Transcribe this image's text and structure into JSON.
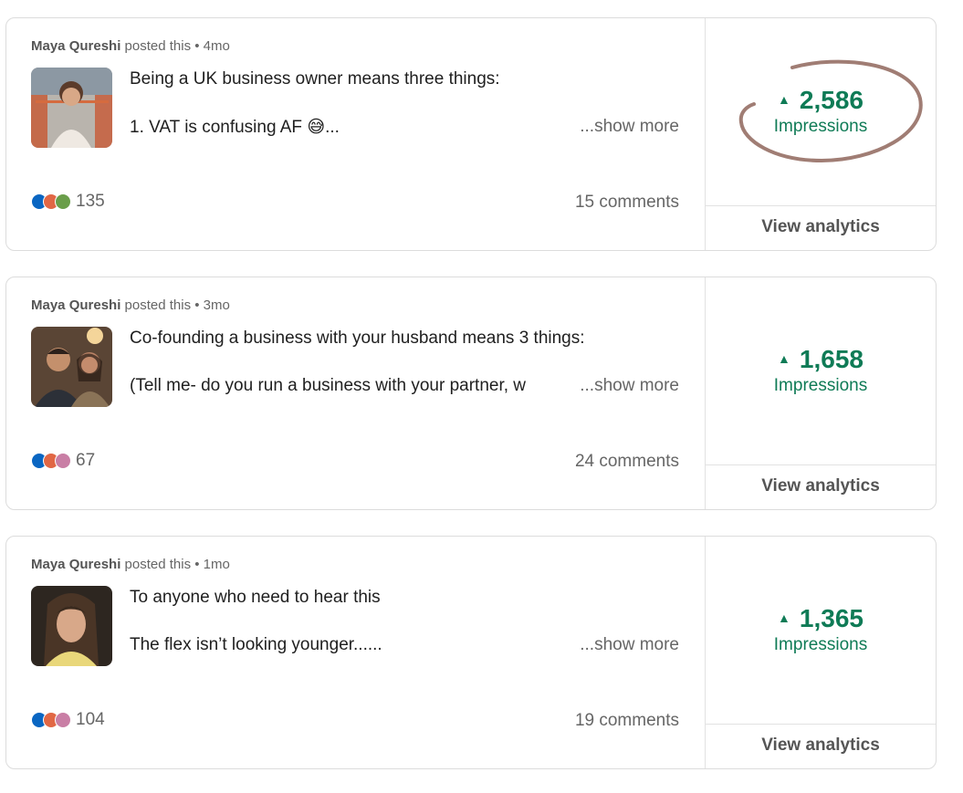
{
  "posts": [
    {
      "author": "Maya Qureshi",
      "meta": " posted this • 4mo",
      "line1": "Being a UK business owner means three things:",
      "line2": "1. VAT is confusing AF 😅...",
      "show_more": "...show more",
      "reactions_count": "135",
      "comments": "15 comments",
      "impressions_value": "2,586",
      "impressions_label": "Impressions",
      "view_analytics": "View analytics",
      "reaction_icons": [
        "like",
        "celebrate",
        "support"
      ]
    },
    {
      "author": "Maya Qureshi",
      "meta": " posted this • 3mo",
      "line1": "Co-founding a business with your husband means 3 things:",
      "line2": "(Tell me- do you run a business with your partner, w",
      "show_more": "...show more",
      "reactions_count": "67",
      "comments": "24 comments",
      "impressions_value": "1,658",
      "impressions_label": "Impressions",
      "view_analytics": "View analytics",
      "reaction_icons": [
        "like",
        "celebrate",
        "love"
      ]
    },
    {
      "author": "Maya Qureshi",
      "meta": " posted this • 1mo",
      "line1": "To anyone who need to hear this",
      "line2": "The flex isn’t looking younger......",
      "show_more": "...show more",
      "reactions_count": "104",
      "comments": "19 comments",
      "impressions_value": "1,365",
      "impressions_label": "Impressions",
      "view_analytics": "View analytics",
      "reaction_icons": [
        "like",
        "celebrate",
        "love"
      ]
    }
  ],
  "colors": {
    "accent_green": "#0f7b56",
    "annotation_circle": "#a07d74"
  }
}
